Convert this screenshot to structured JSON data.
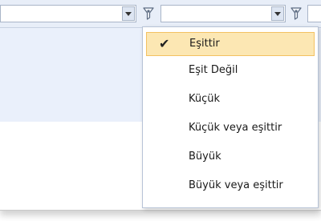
{
  "filter_row": {
    "input_1_value": "",
    "input_2_value": ""
  },
  "menu": {
    "check_glyph": "✔",
    "items": [
      {
        "label": "Eşittir",
        "selected": true
      },
      {
        "label": "Eşit Değil",
        "selected": false
      },
      {
        "label": "Küçük",
        "selected": false
      },
      {
        "label": "Küçük veya eşittir",
        "selected": false
      },
      {
        "label": "Büyük",
        "selected": false
      },
      {
        "label": "Büyük veya eşittir",
        "selected": false
      }
    ]
  },
  "colors": {
    "selected_bg": "#fce7b3",
    "selected_border": "#f3c162",
    "header_bg": "#e8eef8",
    "band_bg": "#eaf0fb"
  },
  "icons": {
    "dropdown": "chevron-down-icon",
    "filter": "filter-icon"
  }
}
